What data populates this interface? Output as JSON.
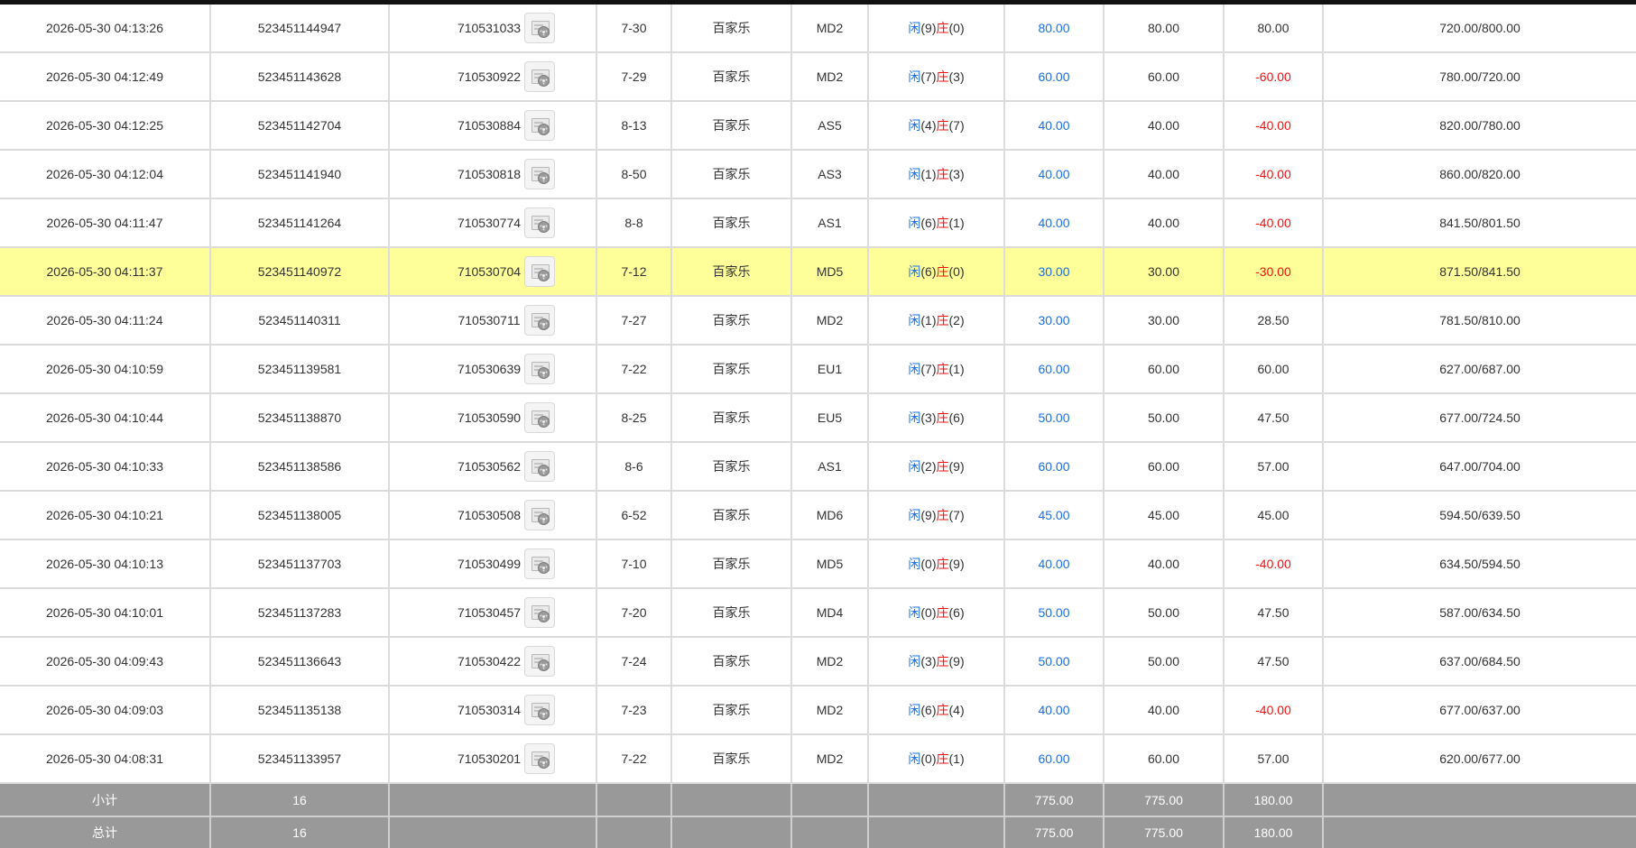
{
  "rows": [
    {
      "time": "2026-05-30 04:13:26",
      "bet_id": "523451144947",
      "game_id": "710531033",
      "round": "7-30",
      "game": "百家乐",
      "table": "MD2",
      "player_label": "闲",
      "player_score": "(9)",
      "banker_label": "庄",
      "banker_score": "(0)",
      "bet": "80.00",
      "valid_bet": "80.00",
      "win_loss": "80.00",
      "win_loss_negative": false,
      "balance": "720.00/800.00",
      "highlight": false
    },
    {
      "time": "2026-05-30 04:12:49",
      "bet_id": "523451143628",
      "game_id": "710530922",
      "round": "7-29",
      "game": "百家乐",
      "table": "MD2",
      "player_label": "闲",
      "player_score": "(7)",
      "banker_label": "庄",
      "banker_score": "(3)",
      "bet": "60.00",
      "valid_bet": "60.00",
      "win_loss": "-60.00",
      "win_loss_negative": true,
      "balance": "780.00/720.00",
      "highlight": false
    },
    {
      "time": "2026-05-30 04:12:25",
      "bet_id": "523451142704",
      "game_id": "710530884",
      "round": "8-13",
      "game": "百家乐",
      "table": "AS5",
      "player_label": "闲",
      "player_score": "(4)",
      "banker_label": "庄",
      "banker_score": "(7)",
      "bet": "40.00",
      "valid_bet": "40.00",
      "win_loss": "-40.00",
      "win_loss_negative": true,
      "balance": "820.00/780.00",
      "highlight": false
    },
    {
      "time": "2026-05-30 04:12:04",
      "bet_id": "523451141940",
      "game_id": "710530818",
      "round": "8-50",
      "game": "百家乐",
      "table": "AS3",
      "player_label": "闲",
      "player_score": "(1)",
      "banker_label": "庄",
      "banker_score": "(3)",
      "bet": "40.00",
      "valid_bet": "40.00",
      "win_loss": "-40.00",
      "win_loss_negative": true,
      "balance": "860.00/820.00",
      "highlight": false
    },
    {
      "time": "2026-05-30 04:11:47",
      "bet_id": "523451141264",
      "game_id": "710530774",
      "round": "8-8",
      "game": "百家乐",
      "table": "AS1",
      "player_label": "闲",
      "player_score": "(6)",
      "banker_label": "庄",
      "banker_score": "(1)",
      "bet": "40.00",
      "valid_bet": "40.00",
      "win_loss": "-40.00",
      "win_loss_negative": true,
      "balance": "841.50/801.50",
      "highlight": false
    },
    {
      "time": "2026-05-30 04:11:37",
      "bet_id": "523451140972",
      "game_id": "710530704",
      "round": "7-12",
      "game": "百家乐",
      "table": "MD5",
      "player_label": "闲",
      "player_score": "(6)",
      "banker_label": "庄",
      "banker_score": "(0)",
      "bet": "30.00",
      "valid_bet": "30.00",
      "win_loss": "-30.00",
      "win_loss_negative": true,
      "balance": "871.50/841.50",
      "highlight": true
    },
    {
      "time": "2026-05-30 04:11:24",
      "bet_id": "523451140311",
      "game_id": "710530711",
      "round": "7-27",
      "game": "百家乐",
      "table": "MD2",
      "player_label": "闲",
      "player_score": "(1)",
      "banker_label": "庄",
      "banker_score": "(2)",
      "bet": "30.00",
      "valid_bet": "30.00",
      "win_loss": "28.50",
      "win_loss_negative": false,
      "balance": "781.50/810.00",
      "highlight": false
    },
    {
      "time": "2026-05-30 04:10:59",
      "bet_id": "523451139581",
      "game_id": "710530639",
      "round": "7-22",
      "game": "百家乐",
      "table": "EU1",
      "player_label": "闲",
      "player_score": "(7)",
      "banker_label": "庄",
      "banker_score": "(1)",
      "bet": "60.00",
      "valid_bet": "60.00",
      "win_loss": "60.00",
      "win_loss_negative": false,
      "balance": "627.00/687.00",
      "highlight": false
    },
    {
      "time": "2026-05-30 04:10:44",
      "bet_id": "523451138870",
      "game_id": "710530590",
      "round": "8-25",
      "game": "百家乐",
      "table": "EU5",
      "player_label": "闲",
      "player_score": "(3)",
      "banker_label": "庄",
      "banker_score": "(6)",
      "bet": "50.00",
      "valid_bet": "50.00",
      "win_loss": "47.50",
      "win_loss_negative": false,
      "balance": "677.00/724.50",
      "highlight": false
    },
    {
      "time": "2026-05-30 04:10:33",
      "bet_id": "523451138586",
      "game_id": "710530562",
      "round": "8-6",
      "game": "百家乐",
      "table": "AS1",
      "player_label": "闲",
      "player_score": "(2)",
      "banker_label": "庄",
      "banker_score": "(9)",
      "bet": "60.00",
      "valid_bet": "60.00",
      "win_loss": "57.00",
      "win_loss_negative": false,
      "balance": "647.00/704.00",
      "highlight": false
    },
    {
      "time": "2026-05-30 04:10:21",
      "bet_id": "523451138005",
      "game_id": "710530508",
      "round": "6-52",
      "game": "百家乐",
      "table": "MD6",
      "player_label": "闲",
      "player_score": "(9)",
      "banker_label": "庄",
      "banker_score": "(7)",
      "bet": "45.00",
      "valid_bet": "45.00",
      "win_loss": "45.00",
      "win_loss_negative": false,
      "balance": "594.50/639.50",
      "highlight": false
    },
    {
      "time": "2026-05-30 04:10:13",
      "bet_id": "523451137703",
      "game_id": "710530499",
      "round": "7-10",
      "game": "百家乐",
      "table": "MD5",
      "player_label": "闲",
      "player_score": "(0)",
      "banker_label": "庄",
      "banker_score": "(9)",
      "bet": "40.00",
      "valid_bet": "40.00",
      "win_loss": "-40.00",
      "win_loss_negative": true,
      "balance": "634.50/594.50",
      "highlight": false
    },
    {
      "time": "2026-05-30 04:10:01",
      "bet_id": "523451137283",
      "game_id": "710530457",
      "round": "7-20",
      "game": "百家乐",
      "table": "MD4",
      "player_label": "闲",
      "player_score": "(0)",
      "banker_label": "庄",
      "banker_score": "(6)",
      "bet": "50.00",
      "valid_bet": "50.00",
      "win_loss": "47.50",
      "win_loss_negative": false,
      "balance": "587.00/634.50",
      "highlight": false
    },
    {
      "time": "2026-05-30 04:09:43",
      "bet_id": "523451136643",
      "game_id": "710530422",
      "round": "7-24",
      "game": "百家乐",
      "table": "MD2",
      "player_label": "闲",
      "player_score": "(3)",
      "banker_label": "庄",
      "banker_score": "(9)",
      "bet": "50.00",
      "valid_bet": "50.00",
      "win_loss": "47.50",
      "win_loss_negative": false,
      "balance": "637.00/684.50",
      "highlight": false
    },
    {
      "time": "2026-05-30 04:09:03",
      "bet_id": "523451135138",
      "game_id": "710530314",
      "round": "7-23",
      "game": "百家乐",
      "table": "MD2",
      "player_label": "闲",
      "player_score": "(6)",
      "banker_label": "庄",
      "banker_score": "(4)",
      "bet": "40.00",
      "valid_bet": "40.00",
      "win_loss": "-40.00",
      "win_loss_negative": true,
      "balance": "677.00/637.00",
      "highlight": false
    },
    {
      "time": "2026-05-30 04:08:31",
      "bet_id": "523451133957",
      "game_id": "710530201",
      "round": "7-22",
      "game": "百家乐",
      "table": "MD2",
      "player_label": "闲",
      "player_score": "(0)",
      "banker_label": "庄",
      "banker_score": "(1)",
      "bet": "60.00",
      "valid_bet": "60.00",
      "win_loss": "57.00",
      "win_loss_negative": false,
      "balance": "620.00/677.00",
      "highlight": false
    }
  ],
  "subtotal": {
    "label": "小计",
    "count": "16",
    "bet": "775.00",
    "valid_bet": "775.00",
    "win_loss": "180.00"
  },
  "total": {
    "label": "总计",
    "count": "16",
    "bet": "775.00",
    "valid_bet": "775.00",
    "win_loss": "180.00"
  },
  "colors": {
    "player": "#1a6fe0",
    "banker": "#ee1111",
    "negative": "#ee1111",
    "highlight_row": "#ffff99",
    "summary_bg": "#999999"
  },
  "icons": {
    "replay": "video-replay-icon"
  }
}
